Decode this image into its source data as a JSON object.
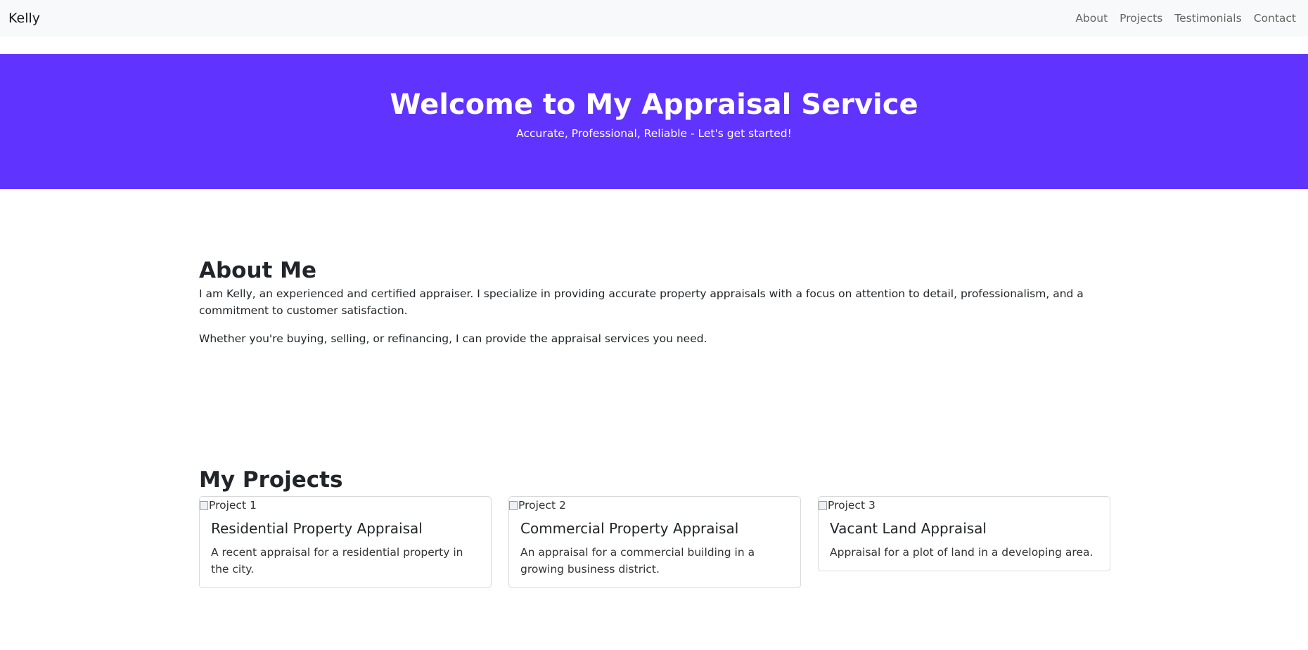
{
  "navbar": {
    "brand": "Kelly",
    "links": [
      "About",
      "Projects",
      "Testimonials",
      "Contact"
    ]
  },
  "hero": {
    "title": "Welcome to My Appraisal Service",
    "subtitle": "Accurate, Professional, Reliable - Let's get started!",
    "background_color": "#6133ff"
  },
  "about": {
    "heading": "About Me",
    "paragraphs": [
      "I am Kelly, an experienced and certified appraiser. I specialize in providing accurate property appraisals with a focus on attention to detail, professionalism, and a commitment to customer satisfaction.",
      "Whether you're buying, selling, or refinancing, I can provide the appraisal services you need."
    ]
  },
  "projects": {
    "heading": "My Projects",
    "cards": [
      {
        "image_alt": "Project 1",
        "title": "Residential Property Appraisal",
        "text": "A recent appraisal for a residential property in the city."
      },
      {
        "image_alt": "Project 2",
        "title": "Commercial Property Appraisal",
        "text": "An appraisal for a commercial building in a growing business district."
      },
      {
        "image_alt": "Project 3",
        "title": "Vacant Land Appraisal",
        "text": "Appraisal for a plot of land in a developing area."
      }
    ]
  }
}
